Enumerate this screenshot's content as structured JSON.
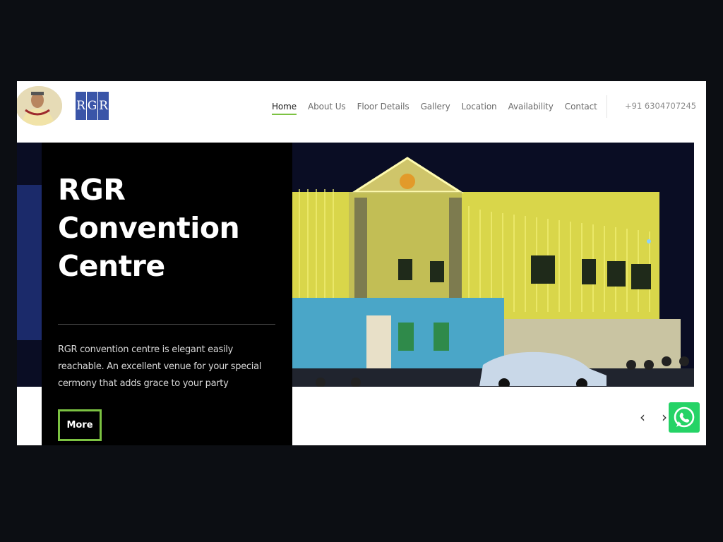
{
  "header": {
    "logo_letters": [
      "R",
      "G",
      "R"
    ],
    "nav": [
      {
        "label": "Home",
        "active": true
      },
      {
        "label": "About Us"
      },
      {
        "label": "Floor Details"
      },
      {
        "label": "Gallery"
      },
      {
        "label": "Location"
      },
      {
        "label": "Availability"
      },
      {
        "label": "Contact"
      }
    ],
    "phone": "+91 6304707245"
  },
  "hero": {
    "title": "RGR Convention Centre",
    "description": "RGR convention centre is elegant easily reachable. An excellent venue for your special cermony that adds grace to your party",
    "more_label": "More"
  },
  "slider": {
    "prev_icon": "chevron-left-icon",
    "next_icon": "chevron-right-icon"
  },
  "colors": {
    "accent": "#7cc242",
    "logo_blue": "#3a55a8",
    "whatsapp": "#25d366",
    "page_bg": "#0c0e13"
  },
  "icons": [
    "owner-photo",
    "whatsapp-icon"
  ]
}
